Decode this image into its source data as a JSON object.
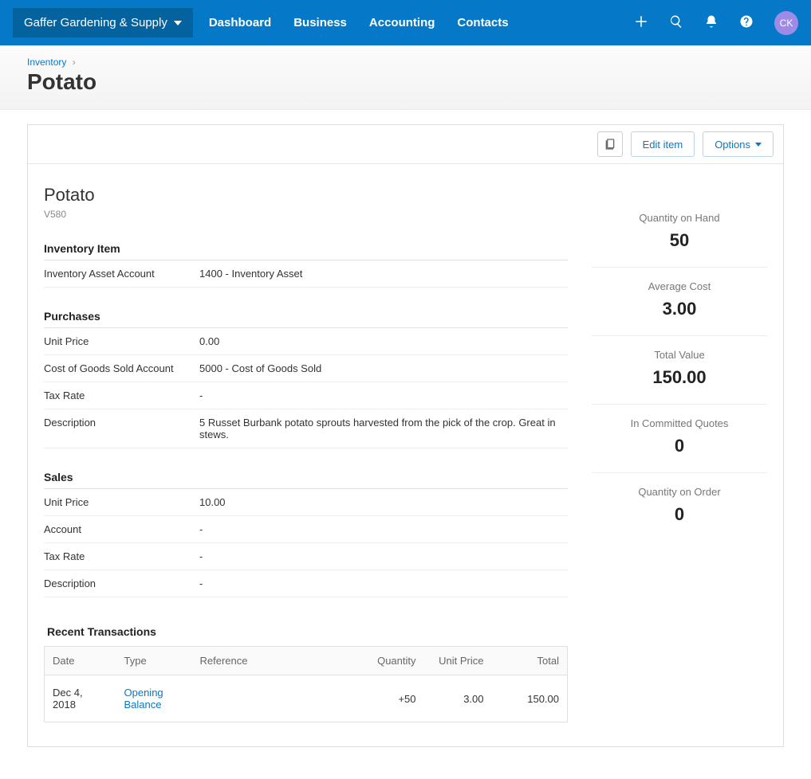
{
  "topbar": {
    "org_name": "Gaffer Gardening & Supply",
    "nav": [
      "Dashboard",
      "Business",
      "Accounting",
      "Contacts"
    ],
    "avatar_initials": "CK"
  },
  "breadcrumb": {
    "parent": "Inventory",
    "sep": "›"
  },
  "page_title": "Potato",
  "toolbar": {
    "edit": "Edit item",
    "options": "Options"
  },
  "item": {
    "name": "Potato",
    "code": "V580"
  },
  "sections": {
    "inventory": {
      "title": "Inventory Item",
      "rows": [
        {
          "label": "Inventory Asset Account",
          "value": "1400 - Inventory Asset"
        }
      ]
    },
    "purchases": {
      "title": "Purchases",
      "rows": [
        {
          "label": "Unit Price",
          "value": "0.00"
        },
        {
          "label": "Cost of Goods Sold Account",
          "value": "5000 - Cost of Goods Sold"
        },
        {
          "label": "Tax Rate",
          "value": "-"
        },
        {
          "label": "Description",
          "value": "5 Russet Burbank potato sprouts harvested from the pick of the crop. Great in stews."
        }
      ]
    },
    "sales": {
      "title": "Sales",
      "rows": [
        {
          "label": "Unit Price",
          "value": "10.00"
        },
        {
          "label": "Account",
          "value": "-"
        },
        {
          "label": "Tax Rate",
          "value": "-"
        },
        {
          "label": "Description",
          "value": "-"
        }
      ]
    }
  },
  "recent": {
    "title": "Recent Transactions",
    "headers": {
      "date": "Date",
      "type": "Type",
      "reference": "Reference",
      "quantity": "Quantity",
      "unit_price": "Unit Price",
      "total": "Total"
    },
    "rows": [
      {
        "date": "Dec 4, 2018",
        "type": "Opening Balance",
        "reference": "",
        "quantity": "+50",
        "unit_price": "3.00",
        "total": "150.00"
      }
    ]
  },
  "stats": [
    {
      "label": "Quantity on Hand",
      "value": "50"
    },
    {
      "label": "Average Cost",
      "value": "3.00"
    },
    {
      "label": "Total Value",
      "value": "150.00"
    },
    {
      "label": "In Committed Quotes",
      "value": "0"
    },
    {
      "label": "Quantity on Order",
      "value": "0"
    }
  ]
}
